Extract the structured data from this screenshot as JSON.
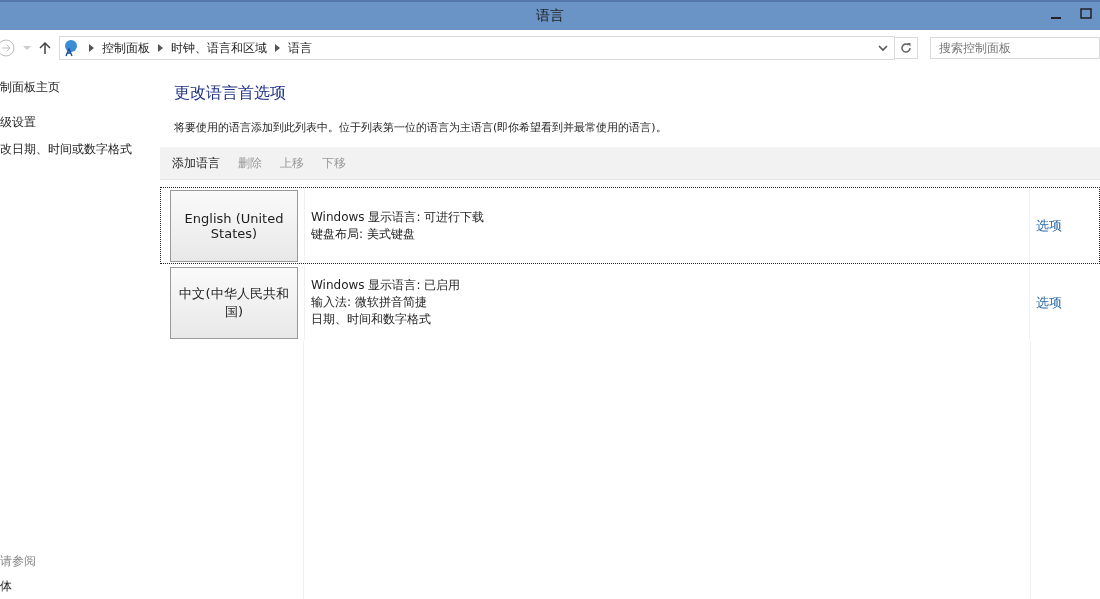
{
  "window": {
    "title": "语言"
  },
  "address_bar": {
    "breadcrumbs": [
      "控制面板",
      "时钟、语言和区域",
      "语言"
    ],
    "search": {
      "placeholder": "搜索控制面板"
    }
  },
  "sidebar": {
    "links": [
      "制面板主页",
      "级设置",
      "改日期、时间或数字格式"
    ],
    "see_also": {
      "heading": "请参阅",
      "links": [
        "体"
      ]
    }
  },
  "main": {
    "heading": "更改语言首选项",
    "description": "将要使用的语言添加到此列表中。位于列表第一位的语言为主语言(即你希望看到并最常使用的语言)。",
    "toolbar": [
      {
        "label": "添加语言",
        "disabled": false
      },
      {
        "label": "删除",
        "disabled": true
      },
      {
        "label": "上移",
        "disabled": true
      },
      {
        "label": "下移",
        "disabled": true
      }
    ],
    "languages": [
      {
        "name": "English (United States)",
        "selected": true,
        "details": [
          "Windows 显示语言: 可进行下载",
          "键盘布局: 美式键盘"
        ],
        "options": "选项"
      },
      {
        "name": "中文(中华人民共和国)",
        "selected": false,
        "details": [
          "Windows 显示语言: 已启用",
          "输入法: 微软拼音简捷",
          "日期、时间和数字格式"
        ],
        "options": "选项"
      }
    ]
  }
}
